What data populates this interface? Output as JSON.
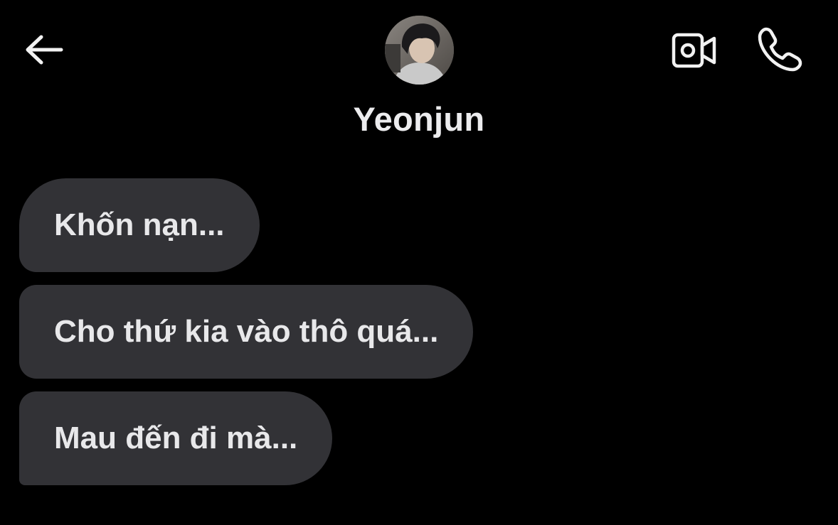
{
  "header": {
    "back_icon": "arrow-left-icon",
    "contact_name": "Yeonjun",
    "avatar_icon": "profile-photo",
    "video_call_icon": "video-camera-icon",
    "voice_call_icon": "phone-icon"
  },
  "messages": [
    {
      "text": "Khốn nạn..."
    },
    {
      "text": "Cho thứ kia vào thô quá..."
    },
    {
      "text": "Mau đến đi mà..."
    }
  ],
  "colors": {
    "background": "#000000",
    "bubble": "#323236",
    "text": "#e8e8ea",
    "icon": "#f2f2f2"
  }
}
